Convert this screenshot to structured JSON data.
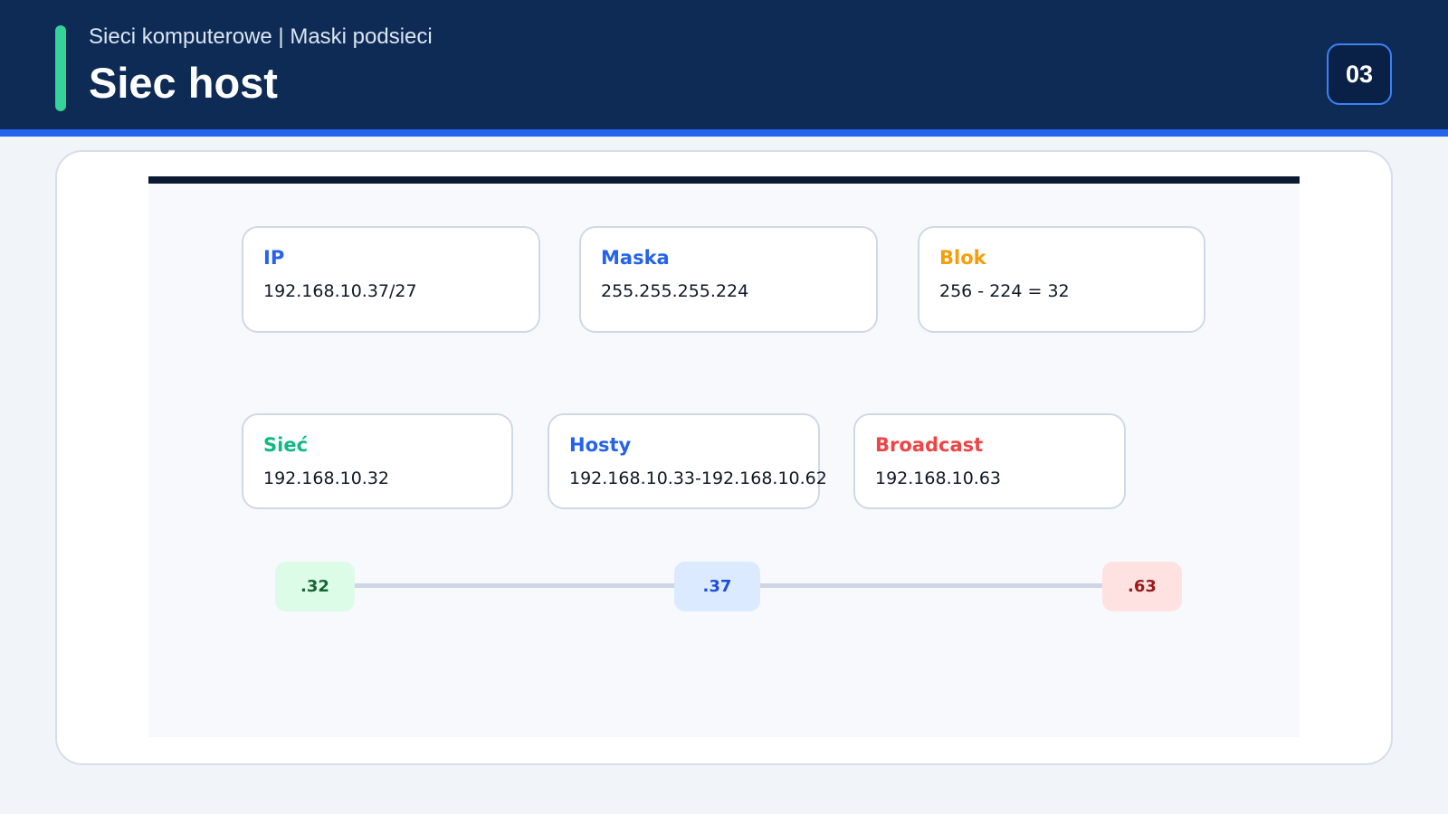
{
  "header": {
    "subtitle": "Sieci komputerowe | Maski podsieci",
    "title": "Siec host",
    "page_number": "03"
  },
  "info_cards": {
    "ip": {
      "label": "IP",
      "value": "192.168.10.37/27",
      "color": "#2563eb"
    },
    "mask": {
      "label": "Maska",
      "value": "255.255.255.224",
      "color": "#2563eb"
    },
    "block": {
      "label": "Blok",
      "value": "256 - 224 = 32",
      "color": "#f59e0b"
    },
    "network": {
      "label": "Sieć",
      "value": "192.168.10.32",
      "color": "#10b981"
    },
    "hosts": {
      "label": "Hosty",
      "value": "192.168.10.33-192.168.10.62",
      "color": "#2563eb"
    },
    "broadcast": {
      "label": "Broadcast",
      "value": "192.168.10.63",
      "color": "#ef4444"
    }
  },
  "range": {
    "network_marker": ".32",
    "host_marker": ".37",
    "broadcast_marker": ".63"
  },
  "colors": {
    "header_bg": "#0d2b55",
    "accent": "#34d399",
    "primary": "#2563eb"
  }
}
